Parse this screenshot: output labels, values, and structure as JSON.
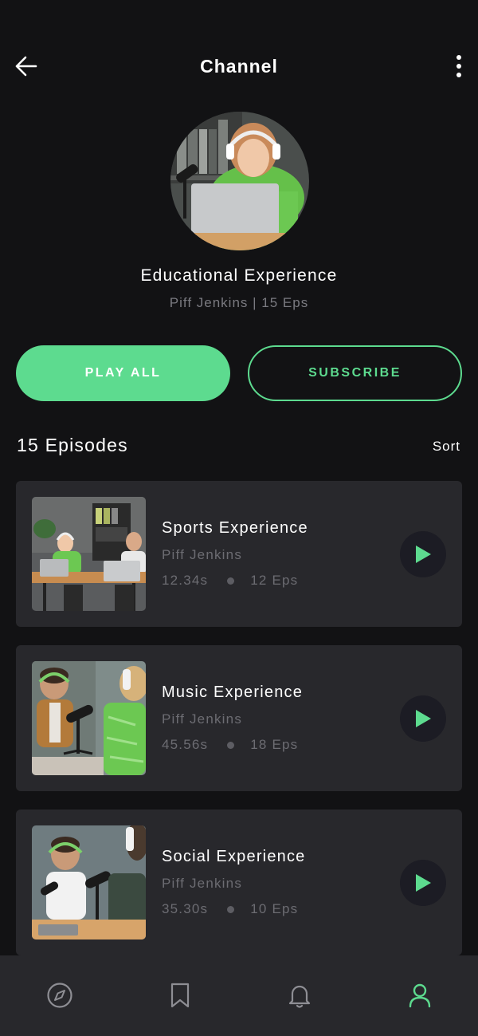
{
  "header": {
    "title": "Channel",
    "back_icon": "arrow-left-icon",
    "more_icon": "more-vertical-icon"
  },
  "channel": {
    "title": "Educational Experience",
    "subtitle": "Piff Jenkins | 15 Eps"
  },
  "actions": {
    "play_all": "PLAY ALL",
    "subscribe": "SUBSCRIBE"
  },
  "episodes_section": {
    "title": "15 Episodes",
    "sort_label": "Sort"
  },
  "episodes": [
    {
      "title": "Sports Experience",
      "author": "Piff Jenkins",
      "duration": "12.34s",
      "eps": "12 Eps"
    },
    {
      "title": "Music Experience",
      "author": "Piff Jenkins",
      "duration": "45.56s",
      "eps": "18 Eps"
    },
    {
      "title": "Social Experience",
      "author": "Piff Jenkins",
      "duration": "35.30s",
      "eps": "10 Eps"
    }
  ],
  "nav": {
    "items": [
      "compass-icon",
      "bookmark-icon",
      "bell-icon",
      "user-icon"
    ],
    "active": "user-icon"
  },
  "colors": {
    "accent": "#5ddb8f",
    "background": "#121214",
    "card": "#28282c"
  }
}
